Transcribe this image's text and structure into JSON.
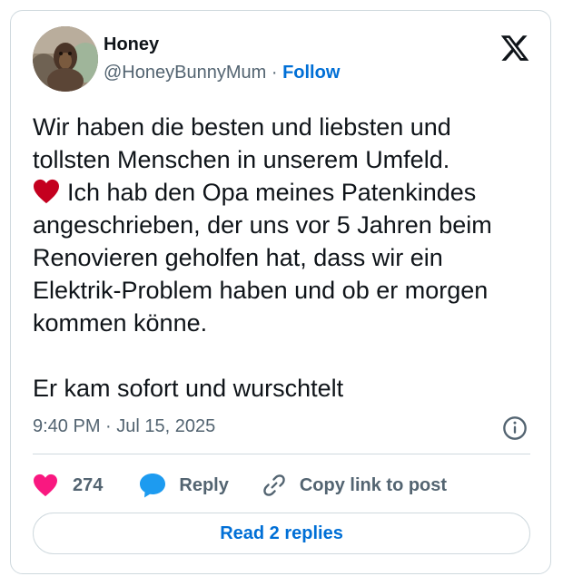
{
  "author": {
    "name": "Honey",
    "handle": "@HoneyBunnyMum",
    "separator": " · ",
    "follow_label": "Follow"
  },
  "tweet": {
    "line_1": "Wir haben die besten und liebsten und tollsten Menschen in unserem Umfeld.",
    "emoji": "red-heart",
    "line_2": "Ich hab den Opa meines Patenkindes angeschrieben, der uns vor 5 Jahren beim Renovieren geholfen hat, dass wir ein Elektrik-Problem haben und ob er morgen kommen könne.",
    "line_3": "Er kam sofort und wurschtelt"
  },
  "timestamp": "9:40 PM · Jul 15, 2025",
  "actions": {
    "like_count": "274",
    "reply_label": "Reply",
    "copy_label": "Copy link to post"
  },
  "read_replies_label": "Read 2 replies",
  "icons": {
    "brand": "x-logo-icon",
    "info": "info-icon",
    "like": "heart-icon",
    "reply": "speech-bubble-icon",
    "copy": "link-icon"
  },
  "colors": {
    "like": "#f91880",
    "reply": "#1d9bf0",
    "link": "#006fd6",
    "text": "#0f1419",
    "muted": "#536471",
    "border": "#cfd9de",
    "emoji_heart": "#c4001f"
  }
}
